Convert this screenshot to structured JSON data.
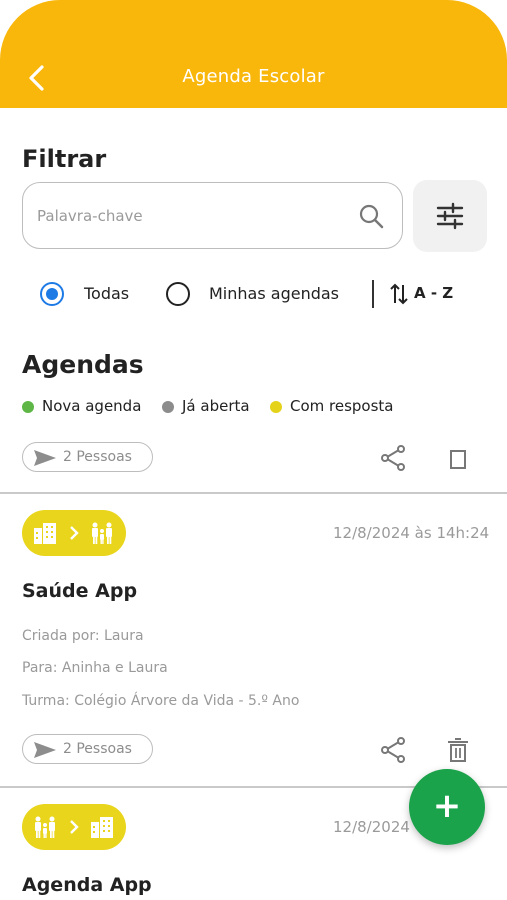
{
  "header": {
    "title": "Agenda Escolar",
    "color": "#F9B70C"
  },
  "filter": {
    "title": "Filtrar",
    "search_placeholder": "Palavra-chave",
    "search_value": ""
  },
  "radios": {
    "options": [
      {
        "label": "Todas",
        "selected": true
      },
      {
        "label": "Minhas agendas",
        "selected": false
      }
    ],
    "sort_label": "A - Z"
  },
  "agendas": {
    "title": "Agendas",
    "legend": [
      {
        "label": "Nova agenda",
        "color": "#5DB646"
      },
      {
        "label": "Já aberta",
        "color": "#8C8C8C"
      },
      {
        "label": "Com resposta",
        "color": "#E5D21A"
      }
    ],
    "cards": [
      {
        "recipients": "2 Pessoas"
      },
      {
        "route": [
          "building-icon",
          "family-icon"
        ],
        "date": "12/8/2024 às 14h:24",
        "title": "Saúde App",
        "created_by": "Criada por: Laura",
        "to": "Para: Aninha e Laura",
        "class": "Turma: Colégio Árvore da Vida - 5.º Ano",
        "recipients": "2 Pessoas"
      },
      {
        "route": [
          "family-icon",
          "building-icon"
        ],
        "date": "12/8/2024",
        "title": "Agenda App"
      }
    ]
  },
  "fab": {
    "label": "+",
    "color": "#1AA34A"
  }
}
